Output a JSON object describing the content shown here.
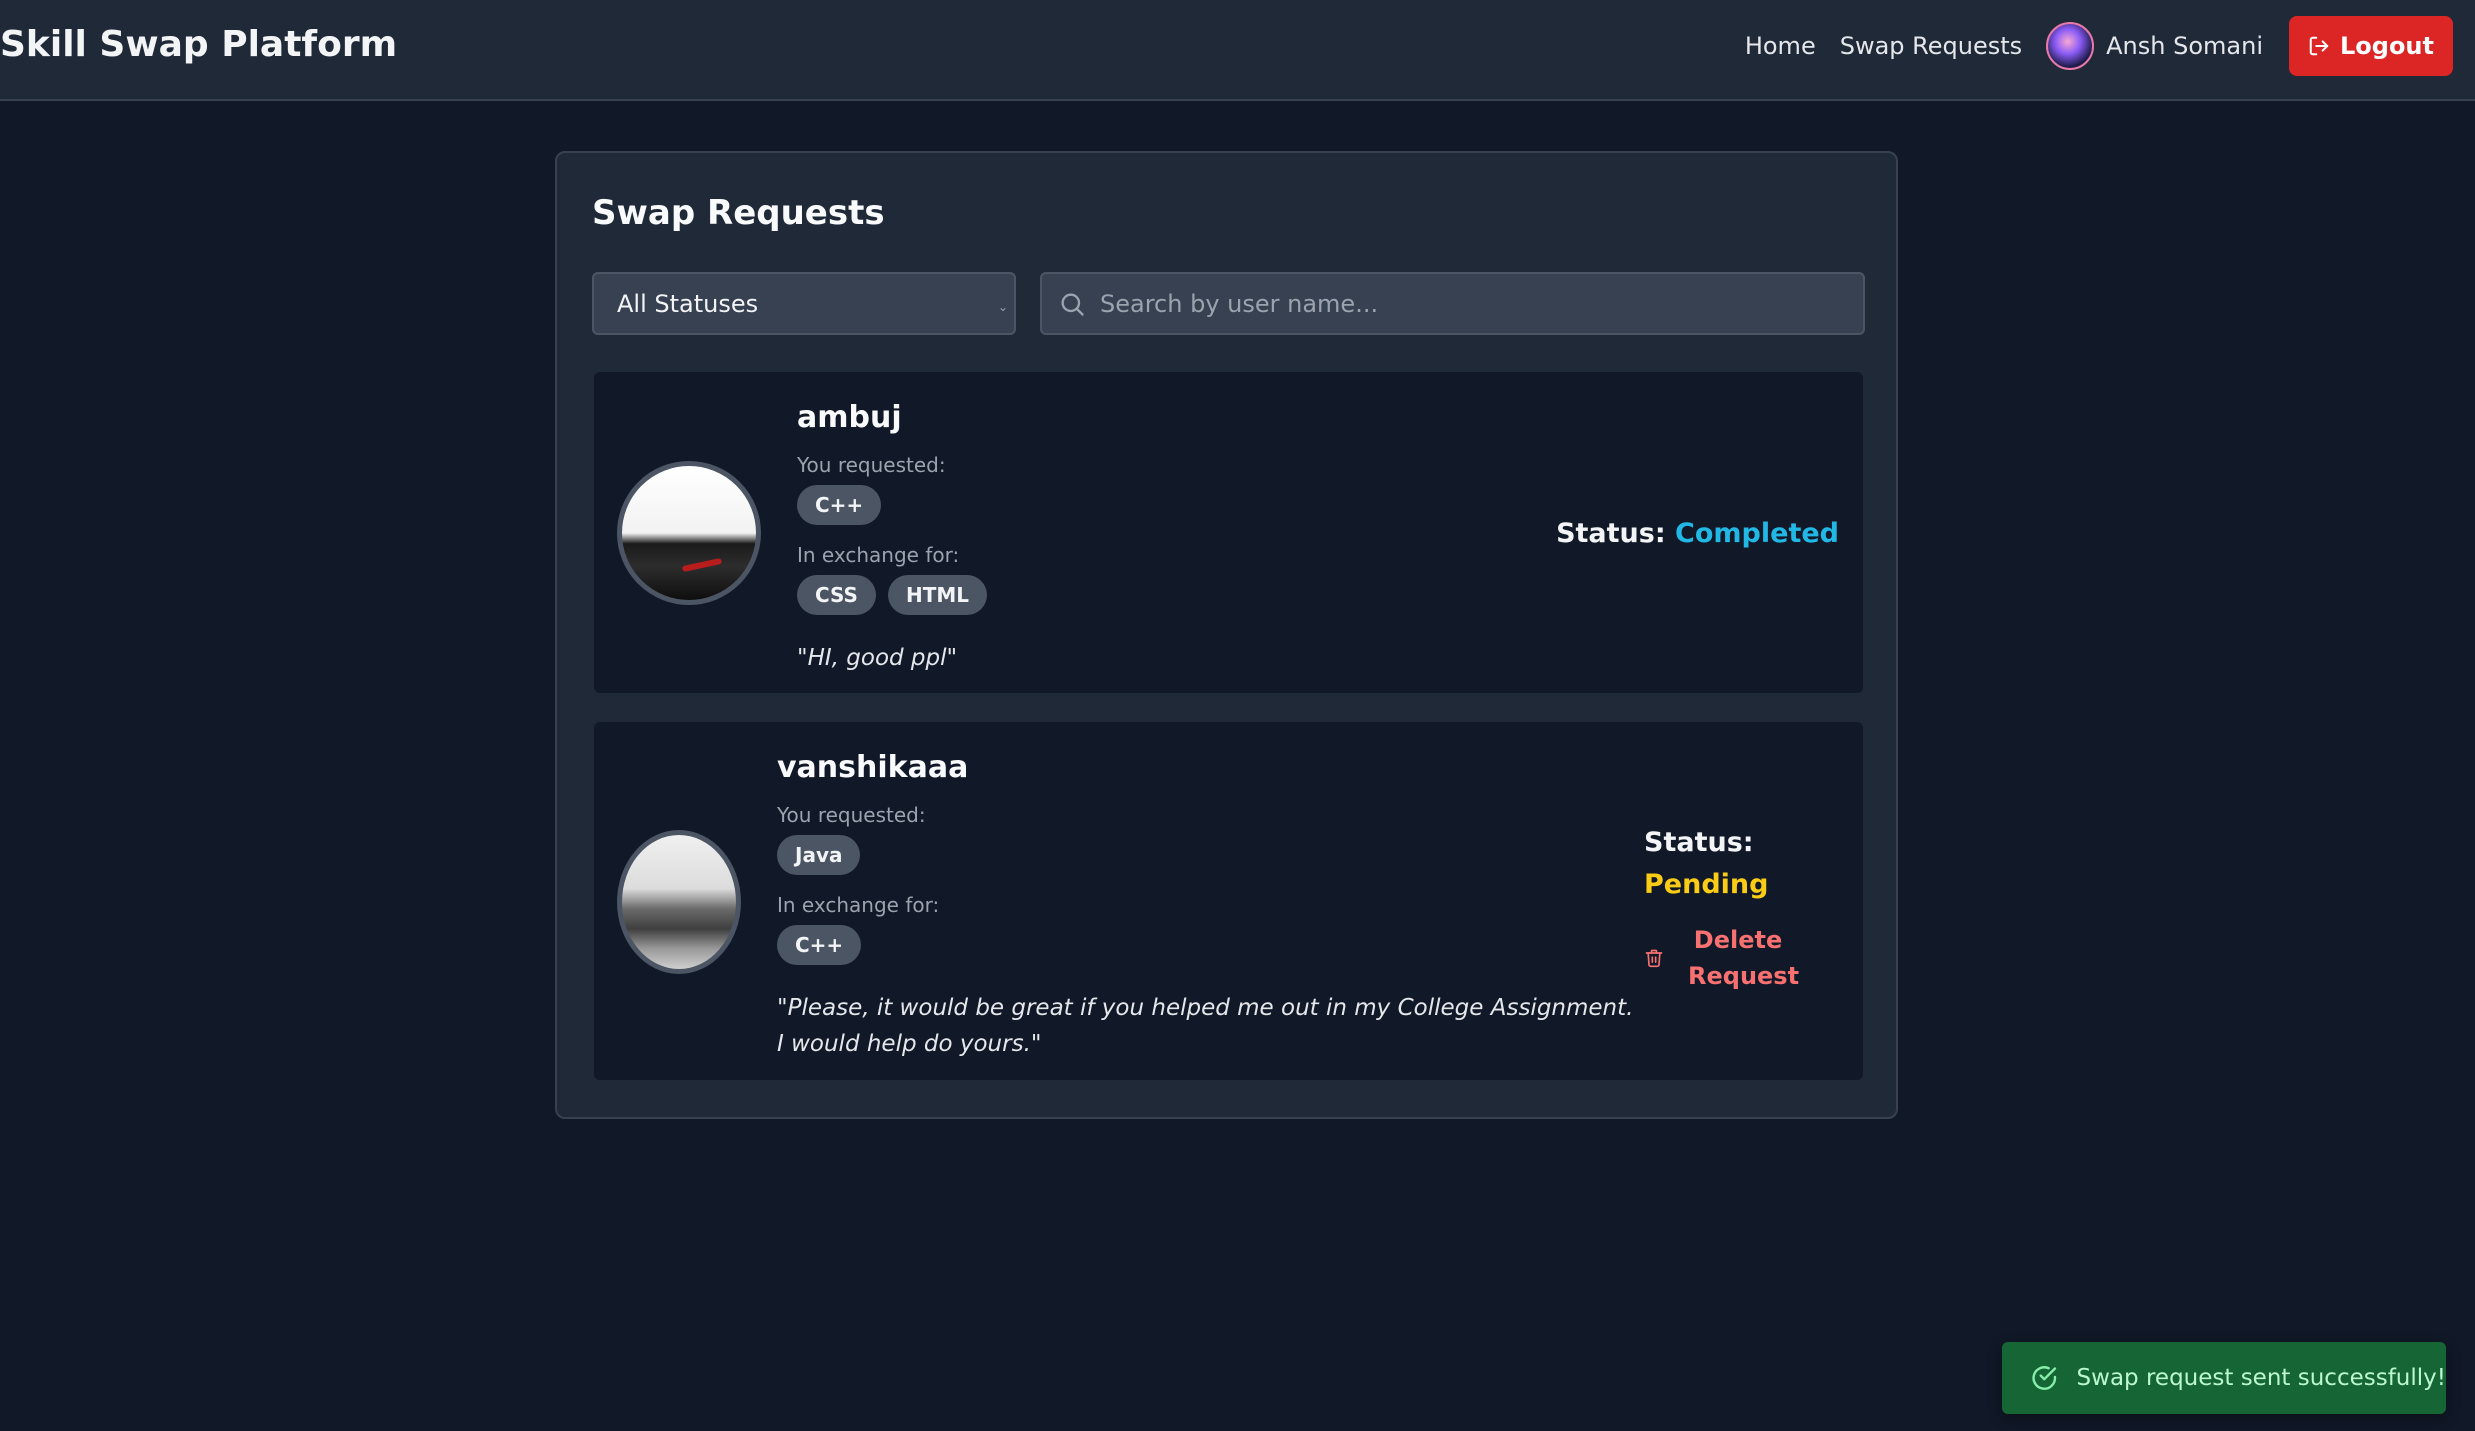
{
  "app": {
    "title": "Skill Swap Platform"
  },
  "nav": {
    "home": "Home",
    "swap_requests": "Swap Requests",
    "user_name": "Ansh Somani",
    "logout": "Logout"
  },
  "page": {
    "title": "Swap Requests"
  },
  "filters": {
    "status_selected": "All Statuses",
    "search_placeholder": "Search by user name..."
  },
  "requests": [
    {
      "user": "ambuj",
      "requested_label": "You requested:",
      "requested": [
        "C++"
      ],
      "exchange_label": "In exchange for:",
      "exchange": [
        "CSS",
        "HTML"
      ],
      "message": "\"HI, good ppl\"",
      "status_label": "Status:",
      "status": "Completed"
    },
    {
      "user": "vanshikaaa",
      "requested_label": "You requested:",
      "requested": [
        "Java"
      ],
      "exchange_label": "In exchange for:",
      "exchange": [
        "C++"
      ],
      "message": "\"Please, it would be great if you helped me out in my College Assignment. I would help do yours.\"",
      "status_label": "Status:",
      "status": "Pending",
      "delete_label": "Delete Request"
    }
  ],
  "toast": {
    "message": "Swap request sent successfully!"
  },
  "colors": {
    "completed": "#22b8e6",
    "pending": "#facc15",
    "danger": "#dc2626",
    "success_toast": "#166534"
  }
}
